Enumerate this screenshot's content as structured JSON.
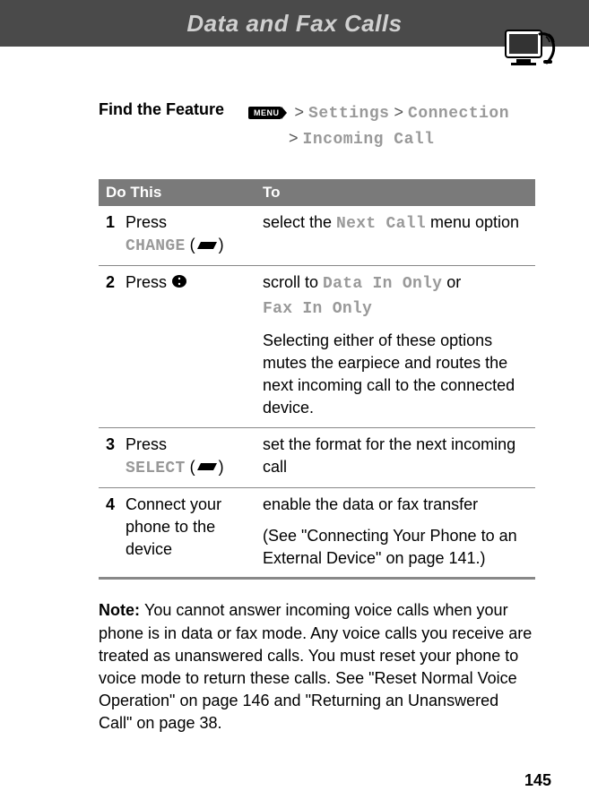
{
  "header": {
    "title": "Data and Fax Calls"
  },
  "findFeature": {
    "label": "Find the Feature",
    "menu": "MENU",
    "sep": ">",
    "p1": "Settings",
    "p2": "Connection",
    "p3": "Incoming Call"
  },
  "table": {
    "h1": "Do This",
    "h2": "To",
    "rows": [
      {
        "n": "1",
        "press": "Press",
        "label": "CHANGE",
        "toA": "select the ",
        "toLabel": "Next Call",
        "toB": " menu option"
      },
      {
        "n": "2",
        "press": "Press ",
        "toA": "scroll to ",
        "toL1": "Data In Only",
        "toOr": " or ",
        "toL2": "Fax In Only",
        "toPara": "Selecting either of these options mutes the earpiece and routes the next incoming call to the connected device."
      },
      {
        "n": "3",
        "press": "Press",
        "label": "SELECT",
        "to": "set the format for the next incoming call"
      },
      {
        "n": "4",
        "action": "Connect your phone to the device",
        "toA": "enable the data or fax transfer",
        "toB": "(See \"Connecting Your Phone to an External Device\" on page 141.)"
      }
    ]
  },
  "note": {
    "label": "Note: ",
    "text": "You cannot answer incoming voice calls when your phone is in data or fax mode. Any voice calls you receive are treated as unanswered calls. You must reset your phone to voice mode to return these calls. See \"Reset Normal Voice Operation\" on page 146 and \"Returning an Unanswered Call\" on page 38."
  },
  "pageNum": "145"
}
